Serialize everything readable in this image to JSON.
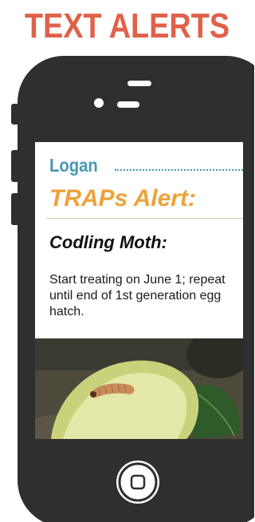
{
  "heading": "TEXT ALERTS",
  "message_card": {
    "location": "Logan",
    "alert_title": "TRAPs Alert:",
    "pest": "Codling Moth:",
    "advice": "Start treating on June 1; repeat until end of 1st generation egg hatch."
  },
  "colors": {
    "heading": "#e0614a",
    "location": "#4a96b5",
    "alert_title": "#eea23a",
    "phone_body": "#2f2f2f"
  },
  "icons": {
    "home_button": "home-button-icon"
  }
}
